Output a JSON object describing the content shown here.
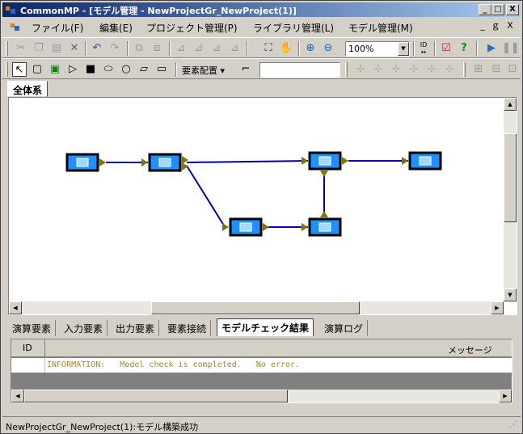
{
  "window": {
    "title": "CommonMP - [モデル管理 - NewProjectGr_NewProject(1)]",
    "caption_buttons": [
      "_",
      "□",
      "X"
    ],
    "mdi_buttons": [
      "_",
      "ｇ",
      "X"
    ]
  },
  "menu": {
    "items": [
      "ファイル(F)",
      "編集(E)",
      "プロジェクト管理(P)",
      "ライブラリ管理(L)",
      "モデル管理(M)"
    ]
  },
  "toolbar1": {
    "icons": [
      "cut-icon",
      "copy-icon",
      "paste-icon",
      "delete-icon",
      "undo-icon",
      "redo-icon",
      "group-icon",
      "ungroup-icon",
      "align-icon",
      "align2-icon",
      "align3-icon",
      "select-area-icon",
      "hand-icon",
      "zoom-in-icon",
      "zoom-out-icon",
      "id-icon",
      "check-icon",
      "help-icon",
      "run-icon",
      "pause-icon"
    ],
    "zoom_value": "100%",
    "id_label": "ID"
  },
  "toolbar2": {
    "layout_label": "要素配置",
    "shapes": [
      "pointer-tool",
      "rect-tool",
      "rect-bold-tool",
      "triangle-tool",
      "filled-rect-tool",
      "ellipse-tool",
      "circle-tool",
      "parallelogram-tool",
      "rounded-rect-tool",
      "connector-tool"
    ]
  },
  "tabs": {
    "top": [
      "全体系"
    ]
  },
  "model": {
    "nodes": [
      "node-1",
      "node-2",
      "node-3",
      "node-4",
      "node-5",
      "node-6"
    ]
  },
  "bottom_tabs": [
    "演算要素",
    "入力要素",
    "出力要素",
    "要素接続",
    "モデルチェック結果",
    "演算ログ"
  ],
  "bottom_active_tab": "モデルチェック結果",
  "result_grid": {
    "columns": [
      "ID",
      "メッセージ"
    ],
    "rows": [
      {
        "id": "",
        "message": "INFORMATION:   Model check is completed.   No error."
      }
    ]
  },
  "status": {
    "text": "NewProjectGr_NewProject(1):モデル構築成功"
  },
  "colors": {
    "title_start": "#0a246a",
    "title_end": "#a6caf0",
    "node_blue": "#1e90ff",
    "connector": "#0000b0",
    "port": "#7a7a00",
    "info_text": "#b8860b"
  }
}
